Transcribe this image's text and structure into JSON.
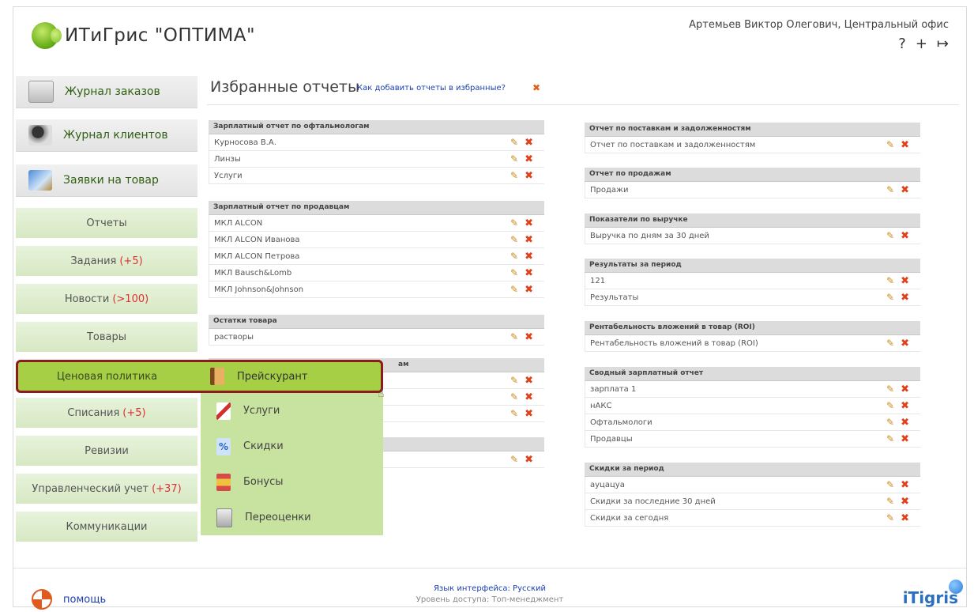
{
  "app": {
    "title": "ИТиГрис \"ОПТИМА\""
  },
  "header": {
    "user": "Артемьев Виктор Олегович, Центральный офис",
    "icons": [
      {
        "name": "help-icon",
        "glyph": "?"
      },
      {
        "name": "add-icon",
        "glyph": "+"
      },
      {
        "name": "logout-icon",
        "glyph": "↦"
      }
    ]
  },
  "nav_big": [
    {
      "label": "Журнал заказов",
      "icon": "orders-journal-icon"
    },
    {
      "label": "Журнал клиентов",
      "icon": "clients-journal-icon"
    },
    {
      "label": "Заявки на товар",
      "icon": "product-requests-icon"
    }
  ],
  "nav": [
    {
      "label": "Отчеты",
      "count": ""
    },
    {
      "label": "Задания",
      "count": "(+5)"
    },
    {
      "label": "Новости",
      "count": "(>100)"
    },
    {
      "label": "Товары",
      "count": ""
    },
    {
      "label": "Ценовая политика",
      "count": ""
    },
    {
      "label": "Списания",
      "count": "(+5)"
    },
    {
      "label": "Ревизии",
      "count": ""
    },
    {
      "label": "Управленческий учет",
      "count": "(+37)"
    },
    {
      "label": "Коммуникации",
      "count": ""
    }
  ],
  "submenu": {
    "highlighted": "Прейскурант",
    "items": [
      "Услуги",
      "Скидки",
      "Бонусы",
      "Переоценки"
    ]
  },
  "main": {
    "title": "Избранные отчеты",
    "help_link": "Как добавить отчеты в избранные?",
    "left_groups": [
      {
        "title": "Зарплатный отчет по офтальмологам",
        "rows": [
          "Курносова В.А.",
          "Линзы",
          "Услуги"
        ]
      },
      {
        "title": "Зарплатный отчет по продавцам",
        "rows": [
          "МКЛ ALCON",
          "МКЛ ALCON Иванова",
          "МКЛ ALCON Петрова",
          "МКЛ Bausch&Lomb",
          "МКЛ Johnson&Johnson"
        ]
      },
      {
        "title": "Остатки товара",
        "rows": [
          "растворы"
        ]
      },
      {
        "title": "ам",
        "rows": [
          "",
          "",
          ""
        ]
      },
      {
        "title": "",
        "rows": [
          ""
        ]
      }
    ],
    "right_groups": [
      {
        "title": "Отчет по поставкам и задолженностям",
        "rows": [
          "Отчет по поставкам и задолженностям"
        ]
      },
      {
        "title": "Отчет по продажам",
        "rows": [
          "Продажи"
        ]
      },
      {
        "title": "Показатели по выручке",
        "rows": [
          "Выручка по дням за 30 дней"
        ]
      },
      {
        "title": "Результаты за период",
        "rows": [
          "121",
          "Результаты"
        ]
      },
      {
        "title": "Рентабельность вложений в товар (ROI)",
        "rows": [
          "Рентабельность вложений в товар (ROI)"
        ]
      },
      {
        "title": "Сводный зарплатный отчет",
        "rows": [
          "зарплата 1",
          "нАКС",
          "Офтальмологи",
          "Продавцы"
        ]
      },
      {
        "title": "Скидки за период",
        "rows": [
          "ауцацуа",
          "Скидки за последние 30 дней",
          "Скидки за сегодня"
        ]
      }
    ]
  },
  "footer": {
    "help": "помощь",
    "language": "Язык интерфейса: Русский",
    "access": "Уровень доступа: Топ-менеджмент",
    "brand": "iTigris"
  },
  "colors": {
    "accent_green": "#a6cf45",
    "nav_green": "#d6e8c3",
    "link_blue": "#1a3fb0",
    "delete_orange": "#e0401a",
    "highlight_border": "#8c1b1b"
  }
}
